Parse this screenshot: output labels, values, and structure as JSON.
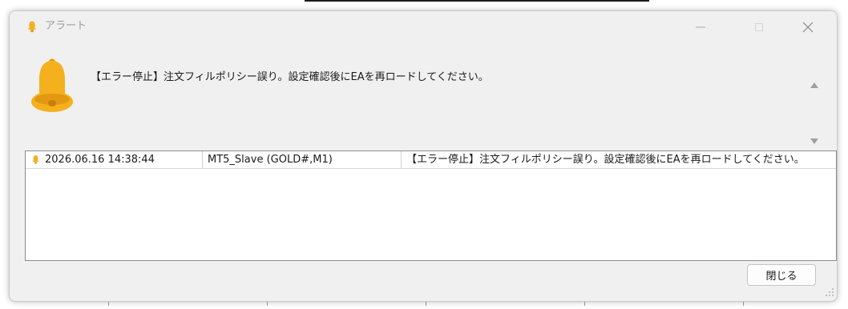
{
  "window": {
    "title": "アラート",
    "controls": {
      "minimize_icon": "minimize-icon",
      "maximize_icon": "maximize-icon",
      "close_icon": "close-icon"
    }
  },
  "alert": {
    "icon": "bell-icon",
    "message": "【エラー停止】注文フィルポリシー誤り。設定確認後にEAを再ロードしてください。"
  },
  "log": {
    "rows": [
      {
        "icon": "bell-icon",
        "time": "2026.06.16 14:38:44",
        "expert": "MT5_Slave (GOLD#,M1)",
        "message": "【エラー停止】注文フィルポリシー誤り。設定確認後にEAを再ロードしてください。"
      }
    ]
  },
  "buttons": {
    "close_label": "閉じる"
  },
  "colors": {
    "bell": "#f5b01e",
    "bell_shade": "#e29812",
    "window_bg": "#f0f0f0",
    "list_bg": "#ffffff",
    "control_gray": "#a8a8a8"
  }
}
